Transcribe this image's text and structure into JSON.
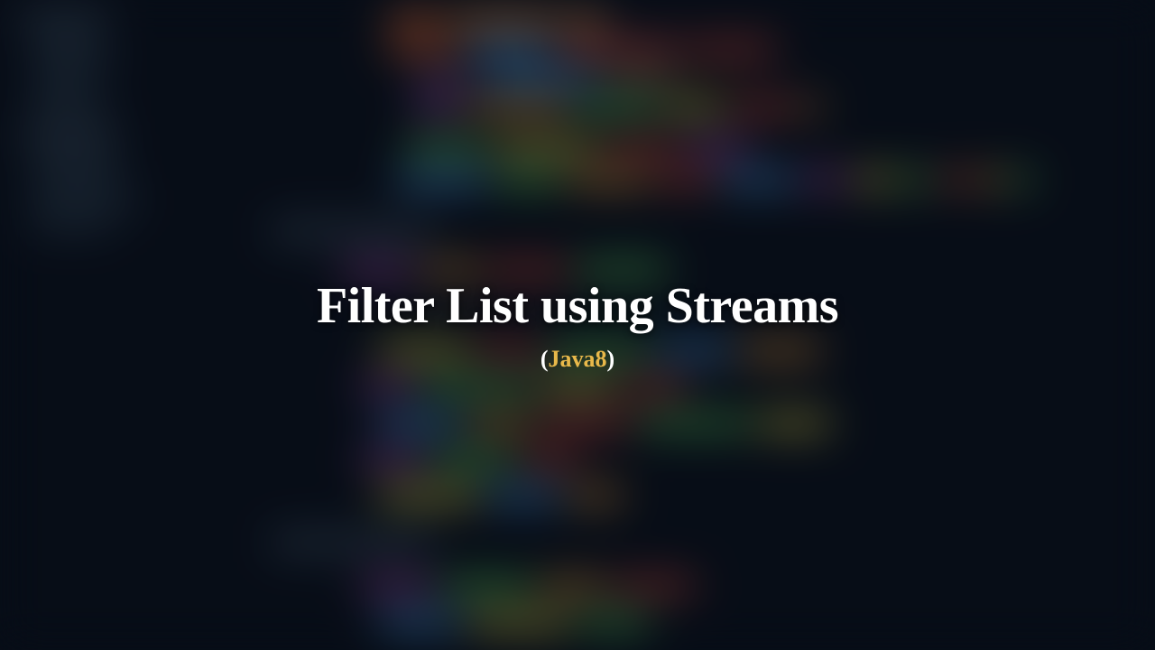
{
  "hero": {
    "title": "Filter List using Streams",
    "subtitle_open": "(",
    "subtitle_text": "Java8",
    "subtitle_close": ")"
  }
}
